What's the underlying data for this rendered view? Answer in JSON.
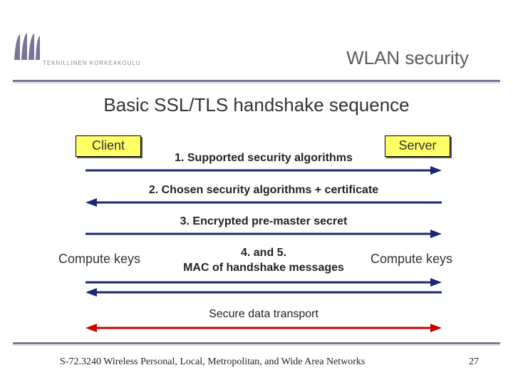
{
  "header": {
    "org_text": "TEKNILLINEN KORKEAKOULU",
    "title": "WLAN security"
  },
  "slide_title": "Basic SSL/TLS handshake sequence",
  "actors": {
    "client": "Client",
    "server": "Server"
  },
  "side_labels": {
    "compute_left": "Compute keys",
    "compute_right": "Compute keys"
  },
  "messages": {
    "m1": "1. Supported security algorithms",
    "m2": "2. Chosen security algorithms + certificate",
    "m3": "3. Encrypted pre-master secret",
    "m45a": "4. and 5.",
    "m45b": "MAC of handshake messages",
    "m6": "Secure data transport"
  },
  "footer": {
    "course": "S-72.3240 Wireless Personal, Local, Metropolitan, and Wide Area Networks",
    "page": "27"
  },
  "colors": {
    "accent": "#7a7498",
    "actor_bg": "#ffff66",
    "arrow_navy": "#1a2a6b",
    "arrow_red": "#cc0000"
  }
}
